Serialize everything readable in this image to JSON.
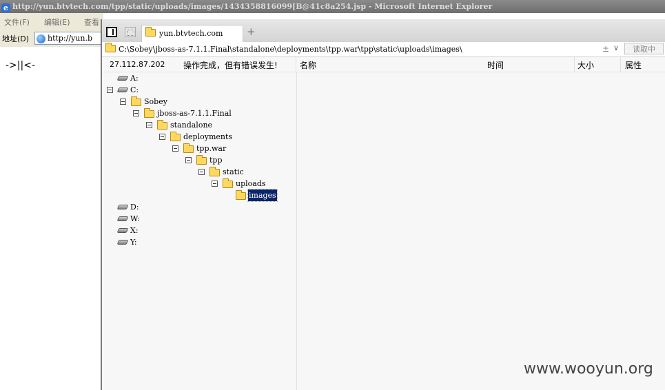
{
  "ie": {
    "title": "http://yun.btvtech.com/tpp/static/uploads/images/1434358816099[B@41c8a254.jsp - Microsoft Internet Explorer",
    "menu": [
      "文件(F)",
      "编辑(E)",
      "查看"
    ],
    "address_label": "地址(D)",
    "address_value": "http://yun.b",
    "page_text": "->||<-"
  },
  "chopper": {
    "tab_label": "yun.btvtech.com",
    "new_tab": "+",
    "path": "C:\\Sobey\\jboss-as-7.1.1.Final\\standalone\\deployments\\tpp.war\\tpp\\static\\uploads\\images\\",
    "path_adjust": "±",
    "path_dropdown": "∨",
    "read_button": "读取中",
    "ip": "27.112.87.202",
    "status": "操作完成，但有错误发生!",
    "columns": {
      "name": "名称",
      "time": "时间",
      "size": "大小",
      "attr": "属性"
    },
    "tree": [
      {
        "label": "A:",
        "type": "drive"
      },
      {
        "label": "C:",
        "type": "drive",
        "expanded": true
      },
      {
        "label": "Sobey",
        "type": "folder",
        "expanded": true
      },
      {
        "label": "jboss-as-7.1.1.Final",
        "type": "folder",
        "expanded": true
      },
      {
        "label": "standalone",
        "type": "folder",
        "expanded": true
      },
      {
        "label": "deployments",
        "type": "folder",
        "expanded": true
      },
      {
        "label": "tpp.war",
        "type": "folder",
        "expanded": true
      },
      {
        "label": "tpp",
        "type": "folder",
        "expanded": true
      },
      {
        "label": "static",
        "type": "folder",
        "expanded": true
      },
      {
        "label": "uploads",
        "type": "folder",
        "expanded": true
      },
      {
        "label": "images",
        "type": "folder",
        "selected": true
      },
      {
        "label": "D:",
        "type": "drive"
      },
      {
        "label": "W:",
        "type": "drive"
      },
      {
        "label": "X:",
        "type": "drive"
      },
      {
        "label": "Y:",
        "type": "drive"
      }
    ]
  },
  "watermark": "www.wooyun.org"
}
